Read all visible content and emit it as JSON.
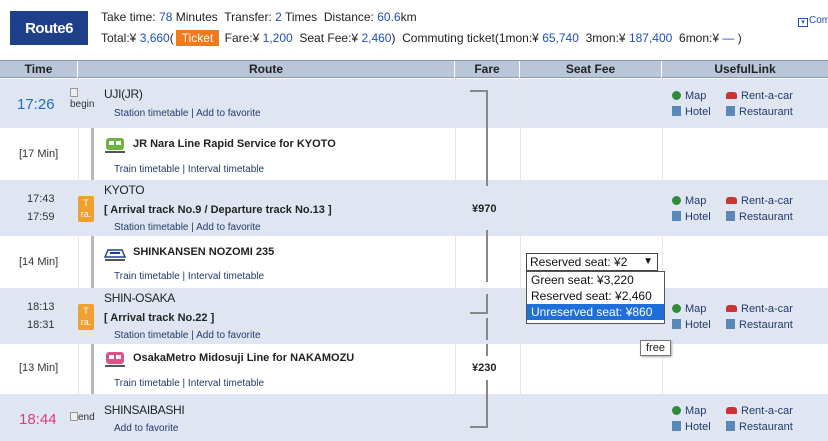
{
  "header": {
    "route_label": "Route6",
    "line1": {
      "take_time_label": "Take time:",
      "take_time_value": "78",
      "minutes_label": "Minutes",
      "transfer_label": "Transfer:",
      "transfer_value": "2",
      "times_label": "Times",
      "distance_label": "Distance:",
      "distance_value": "60.6",
      "km_label": "km"
    },
    "line2": {
      "total_label": "Total:¥",
      "total_value": "3,660",
      "paren_open": "(",
      "ticket_button": "Ticket",
      "fare_label": "Fare:¥",
      "fare_value": "1,200",
      "seat_fee_label": "Seat Fee:¥",
      "seat_fee_value": "2,460",
      "paren_close": ")",
      "commuting_label": "Commuting ticket(1mon:¥",
      "mon1_value": "65,740",
      "mon3_label": "3mon:¥",
      "mon3_value": "187,400",
      "mon6_label": "6mon:¥",
      "mon6_value": "—",
      "end_paren": ")"
    },
    "comm_link": "Com"
  },
  "columns": [
    "Time",
    "Route",
    "Fare",
    "Seat Fee",
    "UsefulLink"
  ],
  "rows": [
    {
      "time": "17:26",
      "img_alt": "begin",
      "station": "UJI(JR)",
      "links": "Station timetable | Add to favorite",
      "useful": [
        "Map",
        "Rent-a-car",
        "Hotel",
        "Restaurant"
      ]
    },
    {
      "mins": "[17 Min]",
      "line": "JR Nara Line Rapid Service  for KYOTO",
      "links": "Train timetable | Interval timetable"
    },
    {
      "time_arr": "17:43",
      "time_dep": "17:59",
      "tra": "T ra.",
      "station": "KYOTO",
      "track": "[ Arrival track No.9 / Departure track No.13 ]",
      "links": "Station timetable | Add to favorite",
      "fare": "¥970",
      "useful": [
        "Map",
        "Rent-a-car",
        "Hotel",
        "Restaurant"
      ]
    },
    {
      "mins": "[14 Min]",
      "line": "SHINKANSEN NOZOMI 235",
      "links": "Train timetable | Interval timetable"
    },
    {
      "time_arr": "18:13",
      "time_dep": "18:31",
      "tra": "T ra.",
      "station": "SHIN-OSAKA",
      "track": "[ Arrival track No.22 ]",
      "links": "Station timetable | Add to favorite",
      "useful": [
        "Map",
        "Rent-a-car",
        "Hotel",
        "Restaurant"
      ]
    },
    {
      "mins": "[13 Min]",
      "line": "OsakaMetro Midosuji Line  for NAKAMOZU",
      "links": "Train timetable | Interval timetable",
      "fare": "¥230"
    },
    {
      "time": "18:44",
      "img_alt": "end",
      "station": "SHINSAIBASHI",
      "links": "Add to favorite",
      "useful": [
        "Map",
        "Rent-a-car",
        "Hotel",
        "Restaurant"
      ]
    }
  ],
  "seat": {
    "selected": "Reserved seat: ¥2",
    "options": [
      "Green seat: ¥3,220",
      "Reserved seat: ¥2,460",
      "Unreserved seat: ¥860"
    ],
    "tooltip": "free"
  }
}
